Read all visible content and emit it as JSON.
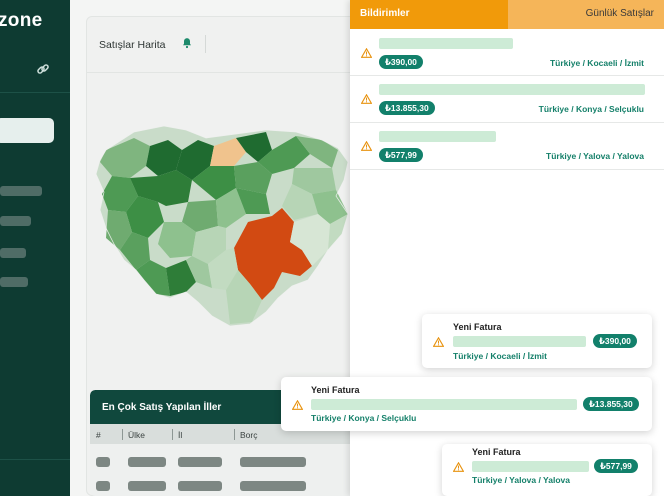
{
  "app": {
    "logo": "zone"
  },
  "map_card": {
    "title": "Satışlar Harita"
  },
  "table": {
    "title": "En Çok Satış Yapılan İller",
    "columns": [
      "#",
      "Ülke",
      "İl",
      "Borç"
    ]
  },
  "notifications": {
    "tabs": [
      "Bildirimler",
      "Günlük Satışlar"
    ],
    "items": [
      {
        "amount": "₺390,00",
        "location": "Türkiye / Kocaeli / İzmit"
      },
      {
        "amount": "₺13.855,30",
        "location": "Türkiye / Konya / Selçuklu"
      },
      {
        "amount": "₺577,99",
        "location": "Türkiye / Yalova / Yalova"
      }
    ]
  },
  "invoices": [
    {
      "title": "Yeni Fatura",
      "amount": "₺390,00",
      "location": "Türkiye / Kocaeli / İzmit"
    },
    {
      "title": "Yeni Fatura",
      "amount": "₺13.855,30",
      "location": "Türkiye / Konya / Selçuklu"
    },
    {
      "title": "Yeni Fatura",
      "amount": "₺577,99",
      "location": "Türkiye / Yalova / Yalova"
    }
  ],
  "colors": {
    "sidebar": "#0e3b32",
    "accent_orange": "#f19a0a",
    "tab_inactive": "#f5b559",
    "pill_green": "#12806b",
    "map_highlight": "#d24a12",
    "map_dark": "#1f6b30"
  }
}
